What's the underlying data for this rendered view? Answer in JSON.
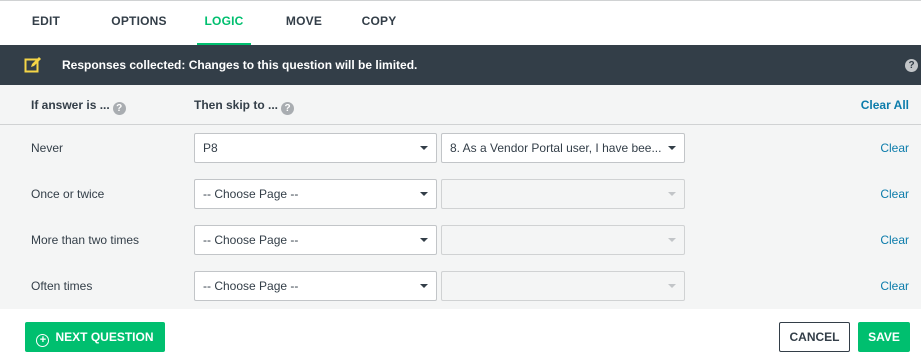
{
  "tabs": [
    {
      "label": "EDIT",
      "active": false
    },
    {
      "label": "OPTIONS",
      "active": false
    },
    {
      "label": "LOGIC",
      "active": true
    },
    {
      "label": "MOVE",
      "active": false
    },
    {
      "label": "COPY",
      "active": false
    }
  ],
  "banner": {
    "text": "Responses collected: Changes to this question will be limited.",
    "icon": "edit-icon",
    "help_glyph": "?"
  },
  "table_header": {
    "if_answer": "If answer is ...",
    "then_skip": "Then skip to ...",
    "help_glyph": "?",
    "clear_all": "Clear All"
  },
  "rows": [
    {
      "answer": "Never",
      "page": "P8",
      "question": "8. As a Vendor Portal user, I have bee...",
      "question_enabled": true,
      "clear": "Clear"
    },
    {
      "answer": "Once or twice",
      "page": "-- Choose Page --",
      "question": "",
      "question_enabled": false,
      "clear": "Clear"
    },
    {
      "answer": "More than two times",
      "page": "-- Choose Page --",
      "question": "",
      "question_enabled": false,
      "clear": "Clear"
    },
    {
      "answer": "Often times",
      "page": "-- Choose Page --",
      "question": "",
      "question_enabled": false,
      "clear": "Clear"
    }
  ],
  "footer": {
    "next_question": "NEXT QUESTION",
    "plus_glyph": "+",
    "cancel": "CANCEL",
    "save": "SAVE"
  },
  "colors": {
    "accent": "#00bf6f",
    "banner_bg": "#333e48",
    "link": "#0c7cab",
    "row_bg": "#f4f5f5"
  }
}
